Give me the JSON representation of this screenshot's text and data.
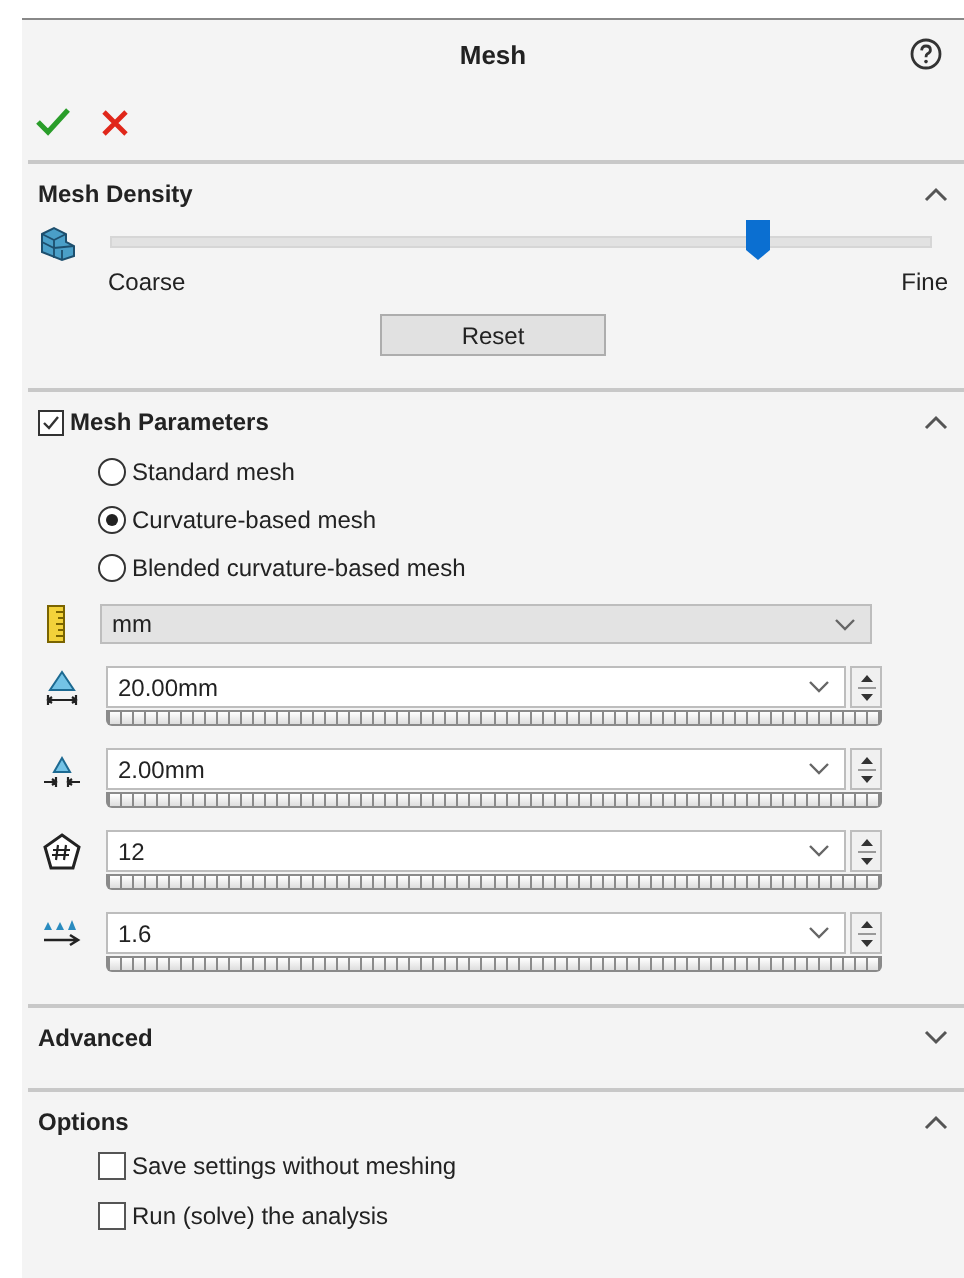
{
  "title": "Mesh",
  "mesh_density": {
    "title": "Mesh Density",
    "expanded": true,
    "level": 0.79,
    "min_label": "Coarse",
    "max_label": "Fine",
    "reset": "Reset"
  },
  "mesh_parameters": {
    "title": "Mesh Parameters",
    "checked": true,
    "expanded": true,
    "options": [
      {
        "label": "Standard mesh",
        "selected": false
      },
      {
        "label": "Curvature-based mesh",
        "selected": true
      },
      {
        "label": "Blended curvature-based mesh",
        "selected": false
      }
    ],
    "units": "mm",
    "fields": [
      {
        "value": "20.00mm"
      },
      {
        "value": "2.00mm"
      },
      {
        "value": "12"
      },
      {
        "value": "1.6"
      }
    ]
  },
  "advanced": {
    "title": "Advanced",
    "expanded": false
  },
  "options": {
    "title": "Options",
    "expanded": true,
    "items": [
      {
        "label": "Save settings without meshing",
        "checked": false
      },
      {
        "label": "Run (solve) the analysis",
        "checked": false
      }
    ]
  }
}
